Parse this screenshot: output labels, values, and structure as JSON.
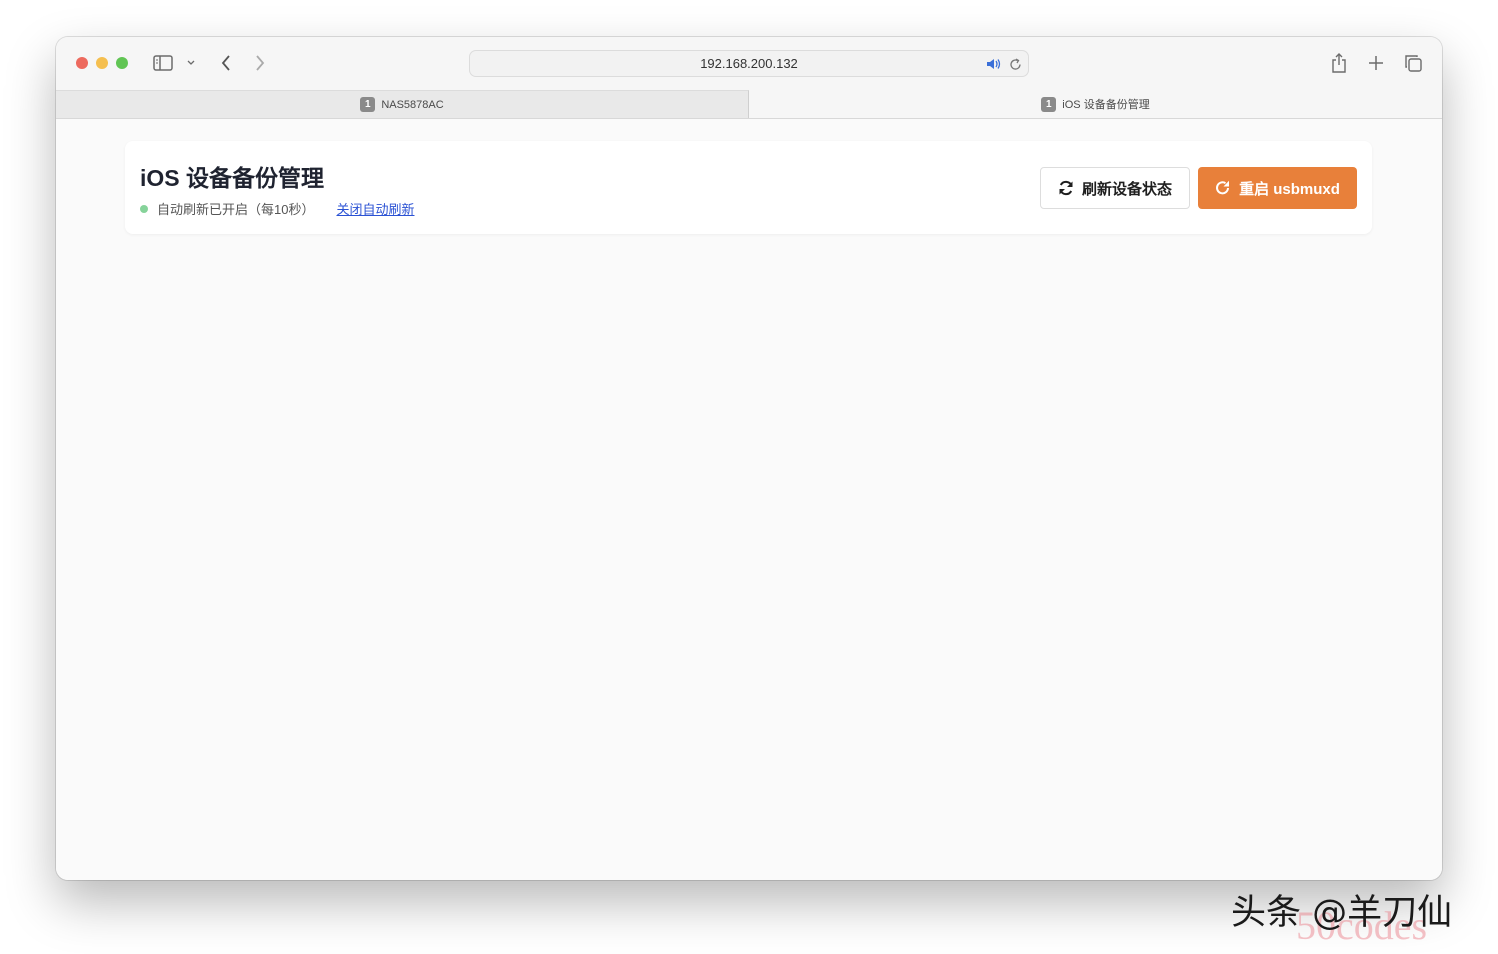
{
  "browser": {
    "address": "192.168.200.132",
    "tabs": [
      {
        "badge": "1",
        "label": "NAS5878AC",
        "active": false
      },
      {
        "badge": "1",
        "label": "iOS 设备备份管理",
        "active": true
      }
    ],
    "icons": {
      "sidebar": "sidebar-icon",
      "back": "chevron-left-icon",
      "forward": "chevron-right-icon",
      "audio": "speaker-icon",
      "reload": "reload-icon",
      "share": "share-icon",
      "new_tab": "plus-icon",
      "tab_overview": "tabs-icon"
    },
    "traffic_colors": [
      "#ed6a5e",
      "#f5bf4f",
      "#61c554"
    ]
  },
  "page": {
    "title": "iOS 设备备份管理",
    "status_text": "自动刷新已开启（每10秒）",
    "toggle_link": "关闭自动刷新",
    "refresh_button": "刷新设备状态",
    "restart_button": "重启 usbmuxd",
    "accent_color": "#e8803a",
    "status_color": "#86d39a"
  },
  "watermark": {
    "text": "头条 @羊刀仙",
    "sub": "50codes"
  }
}
